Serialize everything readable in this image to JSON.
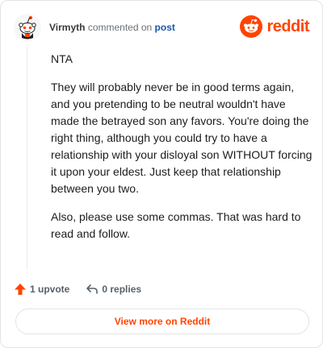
{
  "comment": {
    "author": "Virmyth",
    "action": "commented on",
    "post_link": "post",
    "paragraphs": [
      "NTA",
      "They will probably never be in good terms again, and you pretending to be neutral wouldn't have made the betrayed son any favors. You're doing the right thing, although you could try to have a relationship with your disloyal son WITHOUT forcing it upon your eldest. Just keep that relationship between you two.",
      "Also, please use some commas. That was hard to read and follow."
    ]
  },
  "brand": {
    "name": "reddit",
    "color": "#ff4500"
  },
  "actions": {
    "upvote_label": "1 upvote",
    "reply_label": "0 replies"
  },
  "footer": {
    "view_more_label": "View more on Reddit"
  },
  "icons": {
    "avatar": "reddit-snoo-avatar",
    "logo": "reddit-logo-icon",
    "upvote": "upvote-arrow-icon",
    "reply": "reply-arrow-icon"
  },
  "colors": {
    "accent": "#ff4500",
    "link": "#1b58a6",
    "text": "#1c1c1c",
    "muted": "#576069"
  }
}
